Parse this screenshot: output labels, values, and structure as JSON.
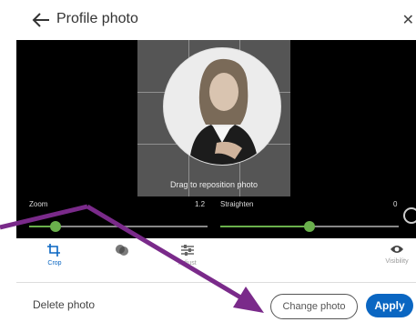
{
  "header": {
    "title": "Profile photo"
  },
  "editor": {
    "drag_hint": "Drag to reposition photo"
  },
  "sliders": {
    "zoom": {
      "label": "Zoom",
      "value": "1.2",
      "fraction": 0.15
    },
    "straighten": {
      "label": "Straighten",
      "value": "0",
      "fraction": 0.5
    }
  },
  "tabs": [
    {
      "label": "Crop",
      "icon": "crop-icon"
    },
    {
      "label": "",
      "icon": "filter-icon"
    },
    {
      "label": "Adjust",
      "icon": "adjust-icon"
    },
    {
      "label": "Visibility",
      "icon": "eye-icon"
    }
  ],
  "footer": {
    "delete_label": "Delete photo",
    "change_label": "Change photo",
    "apply_label": "Apply"
  },
  "colors": {
    "accent": "#0a66c2",
    "slider": "#6ab04c",
    "arrow": "#7a2a8a"
  }
}
